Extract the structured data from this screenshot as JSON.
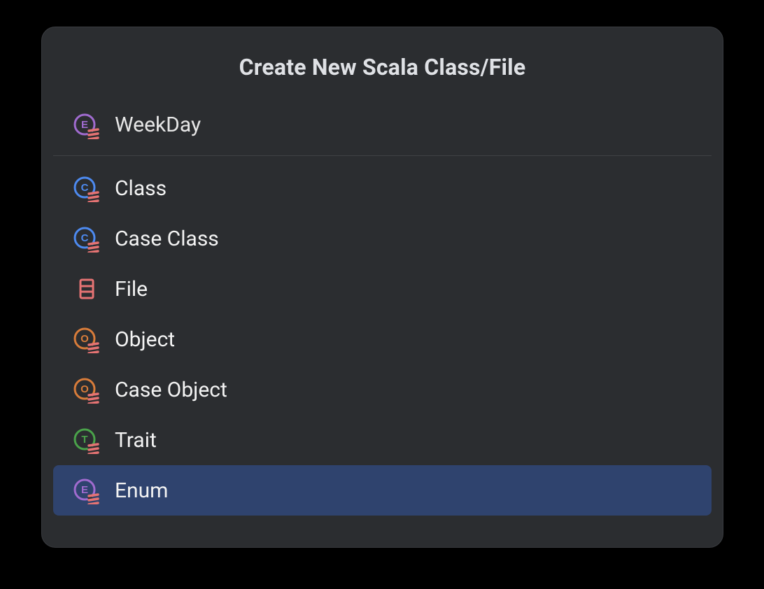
{
  "dialog": {
    "title": "Create New Scala Class/File",
    "input_value": "WeekDay",
    "input_placeholder": "Name",
    "input_icon": "enum-scala-icon",
    "types": [
      {
        "label": "Class",
        "icon": "class-scala-icon",
        "selected": false
      },
      {
        "label": "Case Class",
        "icon": "class-scala-icon",
        "selected": false
      },
      {
        "label": "File",
        "icon": "file-scala-icon",
        "selected": false
      },
      {
        "label": "Object",
        "icon": "object-scala-icon",
        "selected": false
      },
      {
        "label": "Case Object",
        "icon": "object-scala-icon",
        "selected": false
      },
      {
        "label": "Trait",
        "icon": "trait-scala-icon",
        "selected": false
      },
      {
        "label": "Enum",
        "icon": "enum-scala-icon",
        "selected": true
      }
    ]
  },
  "colors": {
    "class": "#4d8af0",
    "object": "#d87c3a",
    "trait": "#4aa24a",
    "enum": "#a06bcf",
    "scala": "#e57373",
    "file": "#e57373"
  }
}
